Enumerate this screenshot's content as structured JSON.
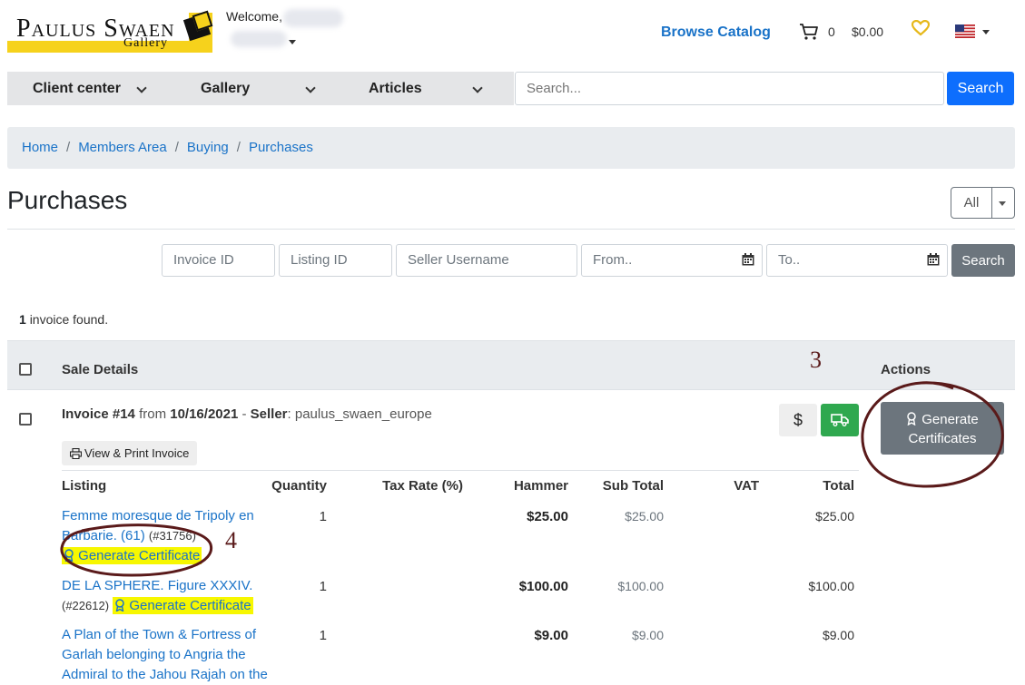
{
  "header": {
    "logo_text": "Paulus Swaen",
    "logo_sub": "Gallery",
    "welcome": "Welcome,",
    "browse_catalog": "Browse Catalog",
    "cart_count": "0",
    "cart_total": "$0.00"
  },
  "nav": {
    "items": [
      "Client center",
      "Gallery",
      "Articles"
    ],
    "search_placeholder": "Search...",
    "search_button": "Search"
  },
  "breadcrumb": [
    "Home",
    "Members Area",
    "Buying",
    "Purchases"
  ],
  "page": {
    "title": "Purchases",
    "filter_select": "All"
  },
  "filters": {
    "invoice_id": "Invoice ID",
    "listing_id": "Listing ID",
    "seller_username": "Seller Username",
    "from": "From..",
    "to": "To..",
    "search_button": "Search"
  },
  "results": {
    "count": "1",
    "text": "invoice found."
  },
  "table": {
    "headers": {
      "sale_details": "Sale Details",
      "actions": "Actions"
    },
    "invoice": {
      "number": "Invoice #14",
      "from_word": "from",
      "date": "10/16/2021",
      "seller_label": "Seller",
      "seller": "paulus_swaen_europe",
      "dollar": "$",
      "generate_certificates": "Generate Certificates",
      "view_print": "View & Print Invoice"
    },
    "line_headers": {
      "listing": "Listing",
      "quantity": "Quantity",
      "tax_rate": "Tax Rate (%)",
      "hammer": "Hammer",
      "subtotal": "Sub Total",
      "vat": "VAT",
      "total": "Total"
    },
    "lines": [
      {
        "title": "Femme moresque de Tripoly en Barbarie. (61)",
        "id": "(#31756)",
        "certificate": "Generate Certificate",
        "quantity": "1",
        "hammer": "$25.00",
        "subtotal": "$25.00",
        "total": "$25.00"
      },
      {
        "title": "DE LA SPHERE. Figure XXXIV.",
        "id": "(#22612)",
        "certificate": "Generate Certificate",
        "quantity": "1",
        "hammer": "$100.00",
        "subtotal": "$100.00",
        "total": "$100.00"
      },
      {
        "title": "A Plan of the Town & Fortress of Garlah belonging to Angria the Admiral to the Jahou Rajah on the",
        "quantity": "1",
        "hammer": "$9.00",
        "subtotal": "$9.00",
        "total": "$9.00"
      }
    ]
  },
  "annotations": {
    "a3": "3",
    "a4": "4"
  }
}
